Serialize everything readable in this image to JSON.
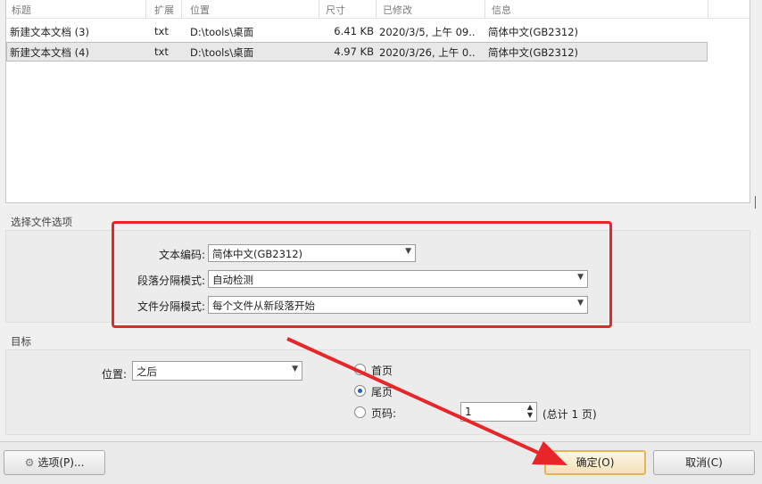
{
  "file_table": {
    "columns": [
      "标题",
      "扩展",
      "位置",
      "尺寸",
      "已修改",
      "信息"
    ],
    "rows": [
      {
        "title": "新建文本文档 (3)",
        "ext": "txt",
        "location": "D:\\tools\\桌面",
        "size": "6.41 KB",
        "modified": "2020/3/5, 上午 09..",
        "info": "简体中文(GB2312)"
      },
      {
        "title": "新建文本文档 (4)",
        "ext": "txt",
        "location": "D:\\tools\\桌面",
        "size": "4.97 KB",
        "modified": "2020/3/26, 上午 0..",
        "info": "简体中文(GB2312)"
      }
    ]
  },
  "file_options": {
    "group_title": "选择文件选项",
    "encoding_label": "文本编码:",
    "encoding_value": "简体中文(GB2312)",
    "paragraph_label": "段落分隔模式:",
    "paragraph_value": "自动检测",
    "file_sep_label": "文件分隔模式:",
    "file_sep_value": "每个文件从新段落开始"
  },
  "target": {
    "group_title": "目标",
    "position_label": "位置:",
    "position_value": "之后",
    "radio_first": "首页",
    "radio_last": "尾页",
    "radio_page": "页码:",
    "selected_radio": "尾页",
    "page_number": "1",
    "total_pages": "(总计 1 页)"
  },
  "buttons": {
    "options": "选项(P)...",
    "ok": "确定(O)",
    "cancel": "取消(C)"
  },
  "colors": {
    "highlight": "#e8262a",
    "arrow": "#e8262a",
    "default_button_border": "#e6b455"
  }
}
